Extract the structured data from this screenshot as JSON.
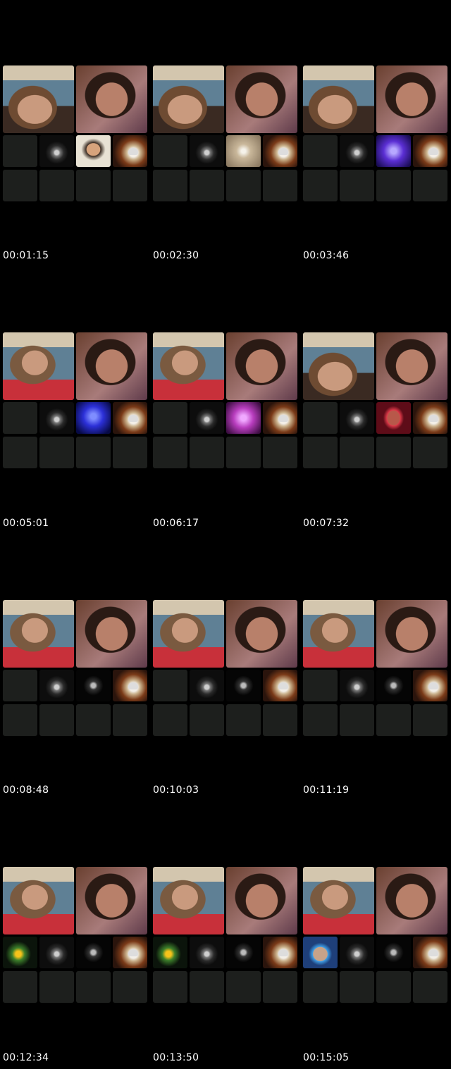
{
  "timestamps": [
    "00:01:15",
    "00:02:30",
    "00:03:46",
    "00:05:01",
    "00:06:17",
    "00:07:32",
    "00:08:48",
    "00:10:03",
    "00:11:19",
    "00:12:34",
    "00:13:50",
    "00:15:05"
  ]
}
